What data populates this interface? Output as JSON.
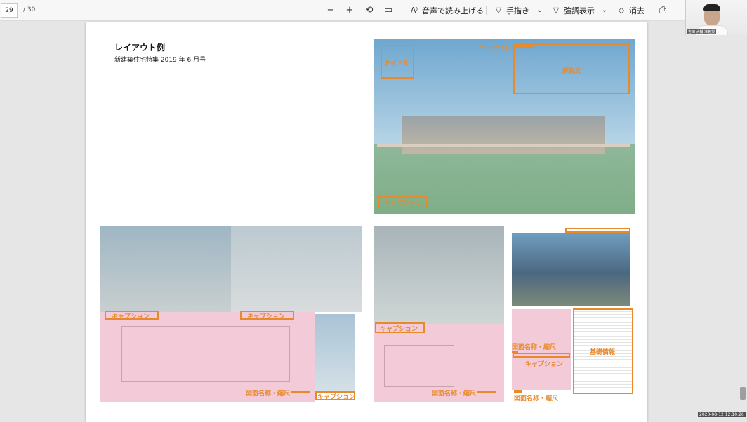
{
  "toolbar": {
    "current_page": "29",
    "total_pages": "/ 30",
    "read_aloud": "音声で読み上げる",
    "draw": "手描き",
    "highlight": "強調表示",
    "erase": "消去"
  },
  "page": {
    "title": "レイアウト例",
    "subtitle": "新建築住宅特集 2019 年 6 月号"
  },
  "labels": {
    "concept": "コンセプト",
    "title_label": "タイトル",
    "commentary": "解説文",
    "caption": "キャプション",
    "drawing_name_scale": "図面名称・縮尺",
    "basic_info": "基礎情報"
  },
  "webcam": {
    "name": "吉田 大輔 准教授"
  },
  "timestamp": "2020-08-12 12:10:26"
}
